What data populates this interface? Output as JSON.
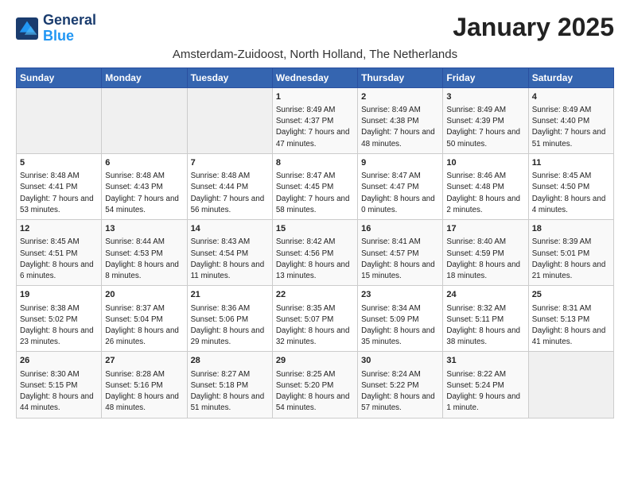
{
  "logo": {
    "line1": "General",
    "line2": "Blue"
  },
  "title": "January 2025",
  "subtitle": "Amsterdam-Zuidoost, North Holland, The Netherlands",
  "weekdays": [
    "Sunday",
    "Monday",
    "Tuesday",
    "Wednesday",
    "Thursday",
    "Friday",
    "Saturday"
  ],
  "weeks": [
    [
      {
        "day": "",
        "info": ""
      },
      {
        "day": "",
        "info": ""
      },
      {
        "day": "",
        "info": ""
      },
      {
        "day": "1",
        "info": "Sunrise: 8:49 AM\nSunset: 4:37 PM\nDaylight: 7 hours and 47 minutes."
      },
      {
        "day": "2",
        "info": "Sunrise: 8:49 AM\nSunset: 4:38 PM\nDaylight: 7 hours and 48 minutes."
      },
      {
        "day": "3",
        "info": "Sunrise: 8:49 AM\nSunset: 4:39 PM\nDaylight: 7 hours and 50 minutes."
      },
      {
        "day": "4",
        "info": "Sunrise: 8:49 AM\nSunset: 4:40 PM\nDaylight: 7 hours and 51 minutes."
      }
    ],
    [
      {
        "day": "5",
        "info": "Sunrise: 8:48 AM\nSunset: 4:41 PM\nDaylight: 7 hours and 53 minutes."
      },
      {
        "day": "6",
        "info": "Sunrise: 8:48 AM\nSunset: 4:43 PM\nDaylight: 7 hours and 54 minutes."
      },
      {
        "day": "7",
        "info": "Sunrise: 8:48 AM\nSunset: 4:44 PM\nDaylight: 7 hours and 56 minutes."
      },
      {
        "day": "8",
        "info": "Sunrise: 8:47 AM\nSunset: 4:45 PM\nDaylight: 7 hours and 58 minutes."
      },
      {
        "day": "9",
        "info": "Sunrise: 8:47 AM\nSunset: 4:47 PM\nDaylight: 8 hours and 0 minutes."
      },
      {
        "day": "10",
        "info": "Sunrise: 8:46 AM\nSunset: 4:48 PM\nDaylight: 8 hours and 2 minutes."
      },
      {
        "day": "11",
        "info": "Sunrise: 8:45 AM\nSunset: 4:50 PM\nDaylight: 8 hours and 4 minutes."
      }
    ],
    [
      {
        "day": "12",
        "info": "Sunrise: 8:45 AM\nSunset: 4:51 PM\nDaylight: 8 hours and 6 minutes."
      },
      {
        "day": "13",
        "info": "Sunrise: 8:44 AM\nSunset: 4:53 PM\nDaylight: 8 hours and 8 minutes."
      },
      {
        "day": "14",
        "info": "Sunrise: 8:43 AM\nSunset: 4:54 PM\nDaylight: 8 hours and 11 minutes."
      },
      {
        "day": "15",
        "info": "Sunrise: 8:42 AM\nSunset: 4:56 PM\nDaylight: 8 hours and 13 minutes."
      },
      {
        "day": "16",
        "info": "Sunrise: 8:41 AM\nSunset: 4:57 PM\nDaylight: 8 hours and 15 minutes."
      },
      {
        "day": "17",
        "info": "Sunrise: 8:40 AM\nSunset: 4:59 PM\nDaylight: 8 hours and 18 minutes."
      },
      {
        "day": "18",
        "info": "Sunrise: 8:39 AM\nSunset: 5:01 PM\nDaylight: 8 hours and 21 minutes."
      }
    ],
    [
      {
        "day": "19",
        "info": "Sunrise: 8:38 AM\nSunset: 5:02 PM\nDaylight: 8 hours and 23 minutes."
      },
      {
        "day": "20",
        "info": "Sunrise: 8:37 AM\nSunset: 5:04 PM\nDaylight: 8 hours and 26 minutes."
      },
      {
        "day": "21",
        "info": "Sunrise: 8:36 AM\nSunset: 5:06 PM\nDaylight: 8 hours and 29 minutes."
      },
      {
        "day": "22",
        "info": "Sunrise: 8:35 AM\nSunset: 5:07 PM\nDaylight: 8 hours and 32 minutes."
      },
      {
        "day": "23",
        "info": "Sunrise: 8:34 AM\nSunset: 5:09 PM\nDaylight: 8 hours and 35 minutes."
      },
      {
        "day": "24",
        "info": "Sunrise: 8:32 AM\nSunset: 5:11 PM\nDaylight: 8 hours and 38 minutes."
      },
      {
        "day": "25",
        "info": "Sunrise: 8:31 AM\nSunset: 5:13 PM\nDaylight: 8 hours and 41 minutes."
      }
    ],
    [
      {
        "day": "26",
        "info": "Sunrise: 8:30 AM\nSunset: 5:15 PM\nDaylight: 8 hours and 44 minutes."
      },
      {
        "day": "27",
        "info": "Sunrise: 8:28 AM\nSunset: 5:16 PM\nDaylight: 8 hours and 48 minutes."
      },
      {
        "day": "28",
        "info": "Sunrise: 8:27 AM\nSunset: 5:18 PM\nDaylight: 8 hours and 51 minutes."
      },
      {
        "day": "29",
        "info": "Sunrise: 8:25 AM\nSunset: 5:20 PM\nDaylight: 8 hours and 54 minutes."
      },
      {
        "day": "30",
        "info": "Sunrise: 8:24 AM\nSunset: 5:22 PM\nDaylight: 8 hours and 57 minutes."
      },
      {
        "day": "31",
        "info": "Sunrise: 8:22 AM\nSunset: 5:24 PM\nDaylight: 9 hours and 1 minute."
      },
      {
        "day": "",
        "info": ""
      }
    ]
  ]
}
